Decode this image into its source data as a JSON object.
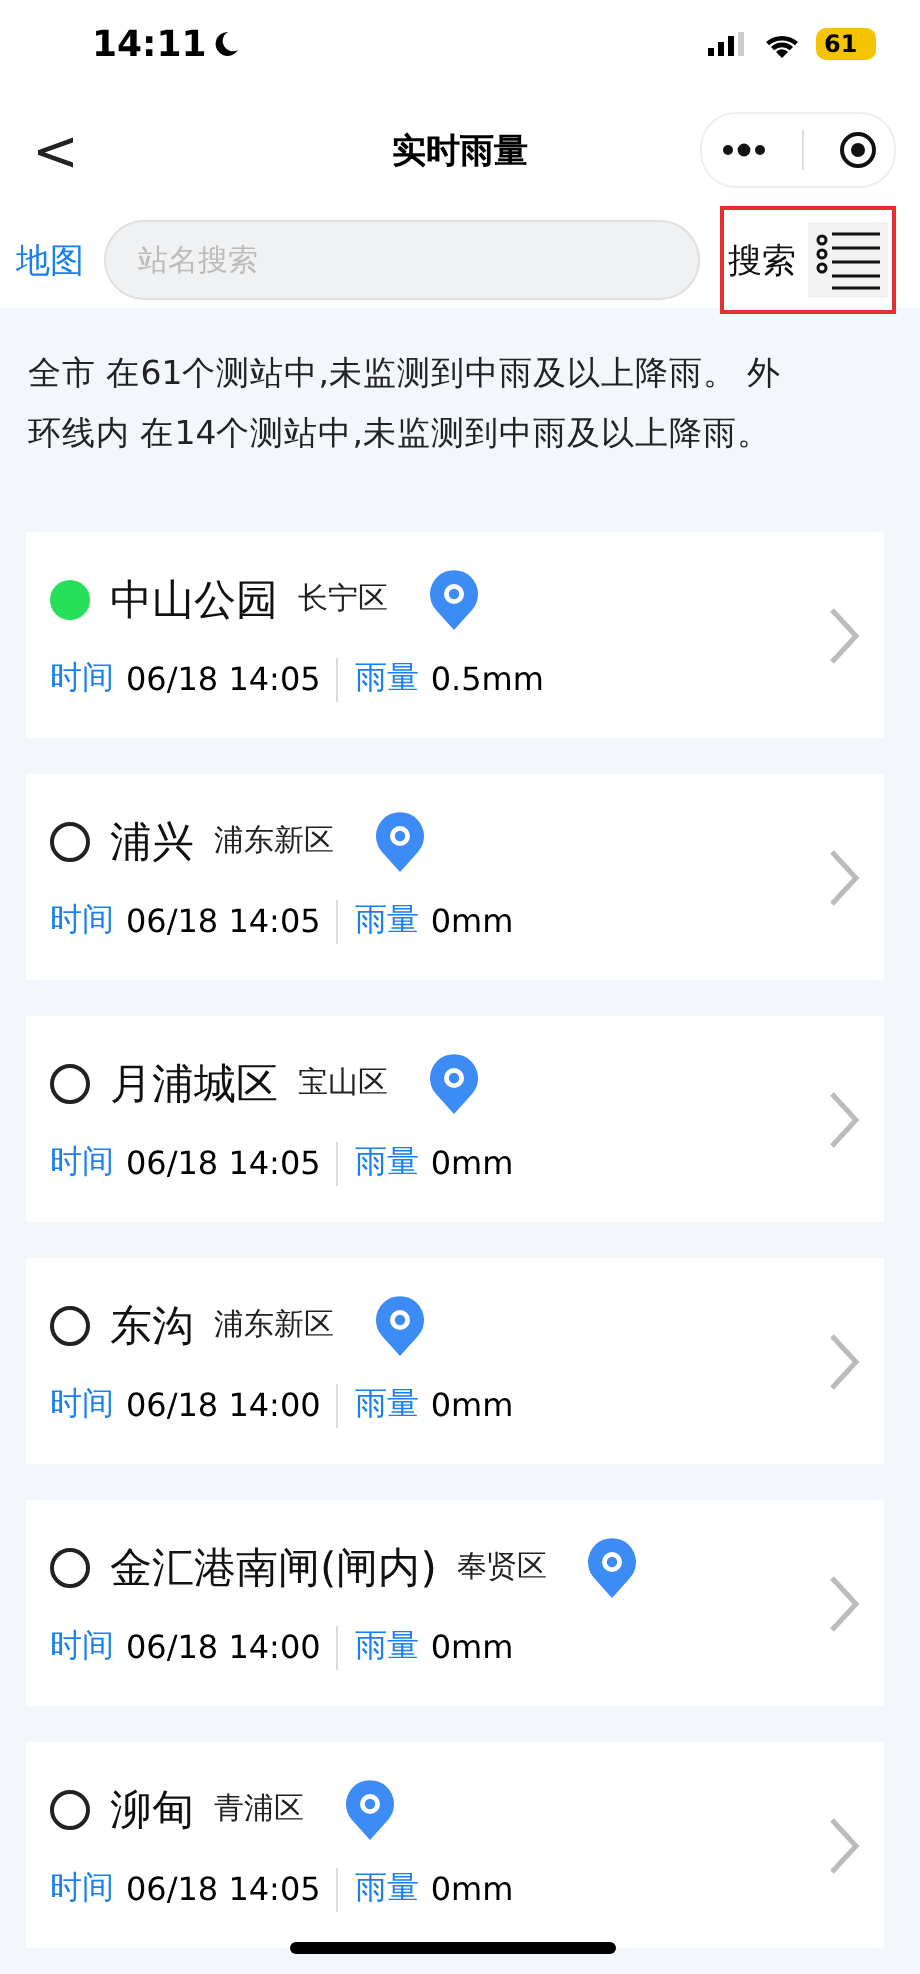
{
  "status_bar": {
    "time": "14:11",
    "battery": "61"
  },
  "nav": {
    "back": "<",
    "title": "实时雨量"
  },
  "search": {
    "map_link": "地图",
    "placeholder": "站名搜索",
    "button": "搜索"
  },
  "summary": "全市 在61个测站中,未监测到中雨及以上降雨。 外环线内 在14个测站中,未监测到中雨及以上降雨。",
  "stations": [
    {
      "name": "中山公园",
      "district": "长宁区",
      "raining": true,
      "time_label": "时间",
      "time": "06/18 14:05",
      "rain_label": "雨量",
      "rain": "0.5mm"
    },
    {
      "name": "浦兴",
      "district": "浦东新区",
      "raining": false,
      "time_label": "时间",
      "time": "06/18 14:05",
      "rain_label": "雨量",
      "rain": "0mm"
    },
    {
      "name": "月浦城区",
      "district": "宝山区",
      "raining": false,
      "time_label": "时间",
      "time": "06/18 14:05",
      "rain_label": "雨量",
      "rain": "0mm"
    },
    {
      "name": "东沟",
      "district": "浦东新区",
      "raining": false,
      "time_label": "时间",
      "time": "06/18 14:00",
      "rain_label": "雨量",
      "rain": "0mm"
    },
    {
      "name": "金汇港南闸(闸内)",
      "district": "奉贤区",
      "raining": false,
      "time_label": "时间",
      "time": "06/18 14:00",
      "rain_label": "雨量",
      "rain": "0mm"
    },
    {
      "name": "泖甸",
      "district": "青浦区",
      "raining": false,
      "time_label": "时间",
      "time": "06/18 14:05",
      "rain_label": "雨量",
      "rain": "0mm"
    }
  ]
}
